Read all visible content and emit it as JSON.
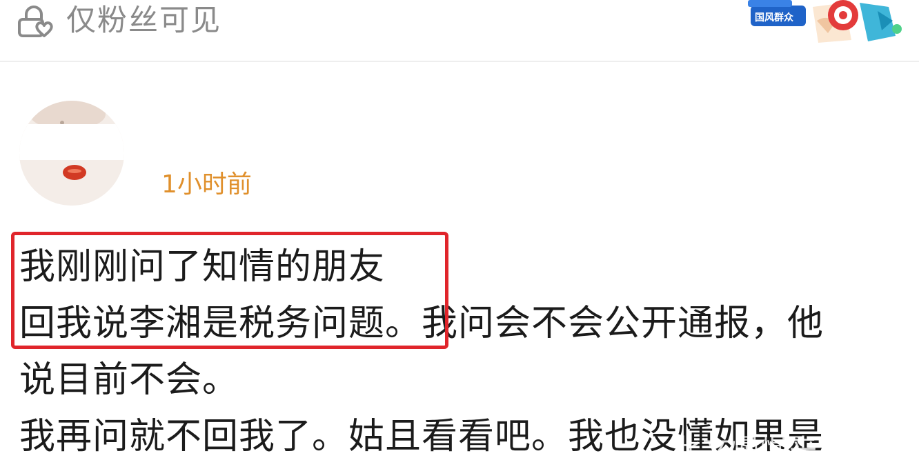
{
  "header": {
    "visibility_label": "仅粉丝可见",
    "visibility_icon": "lock-heart-icon"
  },
  "banner": {
    "text": "国风群众",
    "icon": "mascot-banner"
  },
  "post": {
    "time": "1小时前",
    "lines": [
      "我刚刚问了知情的朋友",
      "回我说李湘是税务问题。我问会不会公开通报，他",
      "说目前不会。",
      "我再问就不回我了。姑且看看吧。我也没懂如果是"
    ]
  },
  "watermark": "此文慢慢来",
  "colors": {
    "timestamp": "#e0902c",
    "highlight_border": "#e0252b",
    "visibility_text": "#8a8a8a"
  }
}
